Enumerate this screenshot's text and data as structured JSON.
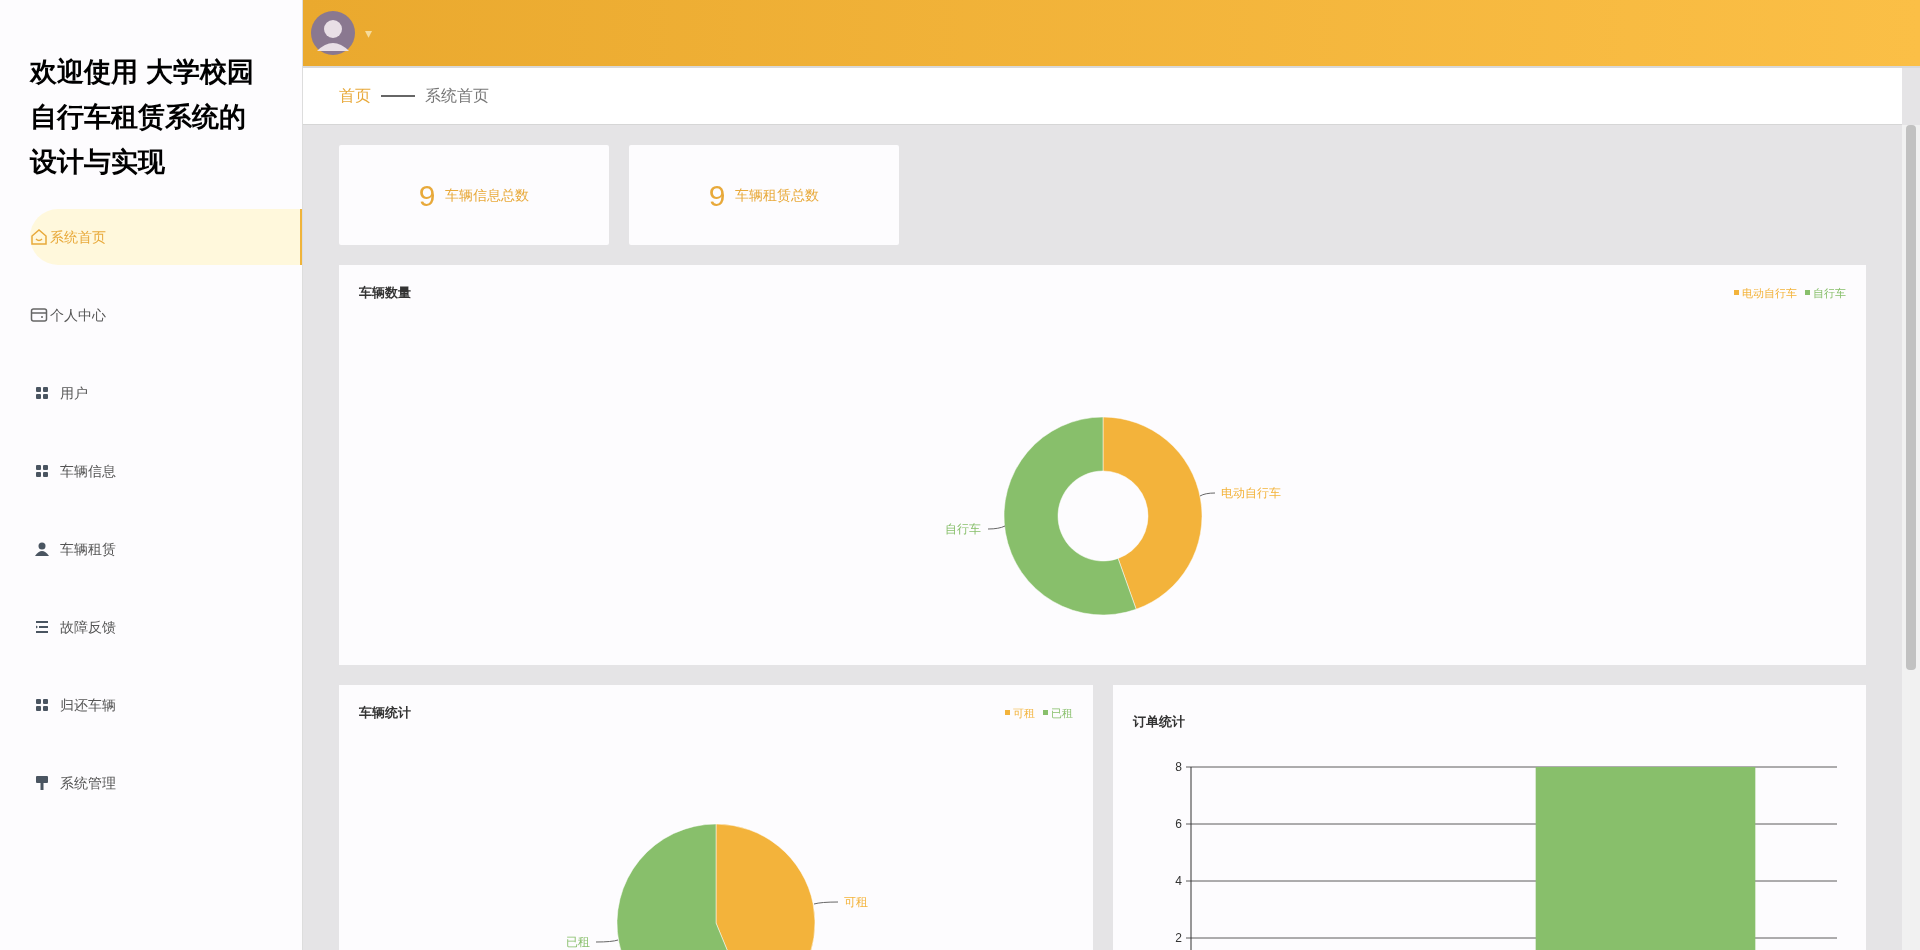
{
  "sidebar": {
    "title": "欢迎使用 大学校园自行车租赁系统的设计与实现",
    "items": [
      {
        "label": "系统首页",
        "kind": "home",
        "selected": true
      },
      {
        "label": "个人中心",
        "kind": "card",
        "selected": false
      },
      {
        "label": "用户",
        "kind": "grid",
        "selected": false
      },
      {
        "label": "车辆信息",
        "kind": "grid",
        "selected": false
      },
      {
        "label": "车辆租赁",
        "kind": "person",
        "selected": false
      },
      {
        "label": "故障反馈",
        "kind": "list",
        "selected": false
      },
      {
        "label": "归还车辆",
        "kind": "grid",
        "selected": false
      },
      {
        "label": "系统管理",
        "kind": "brush",
        "selected": false
      }
    ]
  },
  "header": {
    "user_menu": "▾"
  },
  "breadcrumb": {
    "home": "首页",
    "current": "系统首页"
  },
  "stats": [
    {
      "value": "9",
      "label": "车辆信息总数"
    },
    {
      "value": "9",
      "label": "车辆租赁总数"
    }
  ],
  "vehicle_count": {
    "title": "车辆数量",
    "legend": [
      {
        "label": "电动自行车",
        "color": "#f3b33b"
      },
      {
        "label": "自行车",
        "color": "#88bf6b"
      }
    ],
    "slice_labels": [
      "电动自行车",
      "自行车"
    ]
  },
  "vehicle_stats": {
    "title": "车辆统计",
    "legend": [
      {
        "label": "可租",
        "color": "#f3b33b"
      },
      {
        "label": "已租",
        "color": "#88bf6b"
      }
    ],
    "slice_labels": [
      "可租",
      "已租"
    ]
  },
  "order_stats": {
    "title": "订单统计",
    "chart_data": {
      "type": "bar",
      "ylim": [
        0,
        8
      ],
      "yticks": [
        2,
        4,
        6,
        8
      ],
      "grid": true,
      "series": [
        {
          "color": "#88bf6b",
          "values": [
            null,
            8
          ]
        }
      ]
    }
  }
}
